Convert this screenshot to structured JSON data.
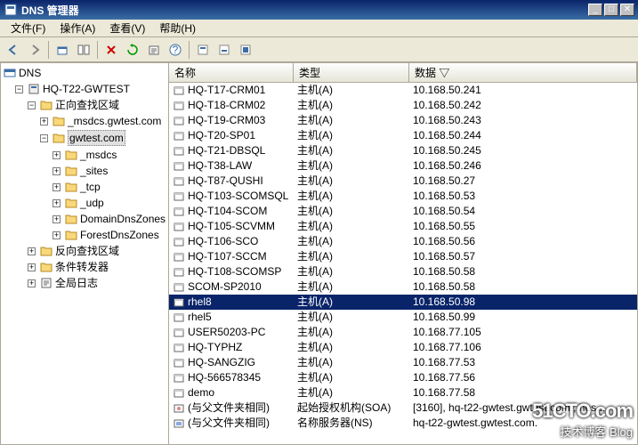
{
  "window": {
    "title": "DNS 管理器"
  },
  "menu": {
    "file": "文件(F)",
    "action": "操作(A)",
    "view": "查看(V)",
    "help": "帮助(H)"
  },
  "toolbar_icons": [
    "back",
    "forward",
    "up",
    "show-hide",
    "delete",
    "refresh",
    "export",
    "help",
    "filter-1",
    "filter-2",
    "filter-3"
  ],
  "columns": {
    "name": "名称",
    "type": "类型",
    "data": "数据  ▽"
  },
  "tree": {
    "root": "DNS",
    "server": "HQ-T22-GWTEST",
    "fwd_zone": "正向查找区域",
    "msdcs": "_msdcs.gwtest.com",
    "zone": "gwtest.com",
    "sub_msdcs": "_msdcs",
    "sub_sites": "_sites",
    "sub_tcp": "_tcp",
    "sub_udp": "_udp",
    "sub_ddz": "DomainDnsZones",
    "sub_fdz": "ForestDnsZones",
    "rev_zone": "反向查找区域",
    "cond_fwd": "条件转发器",
    "global_log": "全局日志"
  },
  "record_type_a": "主机(A)",
  "record_type_soa": "起始授权机构(SOA)",
  "record_type_ns": "名称服务器(NS)",
  "records": [
    {
      "name": "HQ-T17-CRM01",
      "type": "主机(A)",
      "data": "10.168.50.241",
      "sel": false,
      "icon": "host"
    },
    {
      "name": "HQ-T18-CRM02",
      "type": "主机(A)",
      "data": "10.168.50.242",
      "sel": false,
      "icon": "host"
    },
    {
      "name": "HQ-T19-CRM03",
      "type": "主机(A)",
      "data": "10.168.50.243",
      "sel": false,
      "icon": "host"
    },
    {
      "name": "HQ-T20-SP01",
      "type": "主机(A)",
      "data": "10.168.50.244",
      "sel": false,
      "icon": "host"
    },
    {
      "name": "HQ-T21-DBSQL",
      "type": "主机(A)",
      "data": "10.168.50.245",
      "sel": false,
      "icon": "host"
    },
    {
      "name": "HQ-T38-LAW",
      "type": "主机(A)",
      "data": "10.168.50.246",
      "sel": false,
      "icon": "host"
    },
    {
      "name": "HQ-T87-QUSHI",
      "type": "主机(A)",
      "data": "10.168.50.27",
      "sel": false,
      "icon": "host"
    },
    {
      "name": "HQ-T103-SCOMSQL",
      "type": "主机(A)",
      "data": "10.168.50.53",
      "sel": false,
      "icon": "host"
    },
    {
      "name": "HQ-T104-SCOM",
      "type": "主机(A)",
      "data": "10.168.50.54",
      "sel": false,
      "icon": "host"
    },
    {
      "name": "HQ-T105-SCVMM",
      "type": "主机(A)",
      "data": "10.168.50.55",
      "sel": false,
      "icon": "host"
    },
    {
      "name": "HQ-T106-SCO",
      "type": "主机(A)",
      "data": "10.168.50.56",
      "sel": false,
      "icon": "host"
    },
    {
      "name": "HQ-T107-SCCM",
      "type": "主机(A)",
      "data": "10.168.50.57",
      "sel": false,
      "icon": "host"
    },
    {
      "name": "HQ-T108-SCOMSP",
      "type": "主机(A)",
      "data": "10.168.50.58",
      "sel": false,
      "icon": "host"
    },
    {
      "name": "SCOM-SP2010",
      "type": "主机(A)",
      "data": "10.168.50.58",
      "sel": false,
      "icon": "host"
    },
    {
      "name": "rhel8",
      "type": "主机(A)",
      "data": "10.168.50.98",
      "sel": true,
      "icon": "host"
    },
    {
      "name": "rhel5",
      "type": "主机(A)",
      "data": "10.168.50.99",
      "sel": false,
      "icon": "host"
    },
    {
      "name": "USER50203-PC",
      "type": "主机(A)",
      "data": "10.168.77.105",
      "sel": false,
      "icon": "host"
    },
    {
      "name": "HQ-TYPHZ",
      "type": "主机(A)",
      "data": "10.168.77.106",
      "sel": false,
      "icon": "host"
    },
    {
      "name": "HQ-SANGZIG",
      "type": "主机(A)",
      "data": "10.168.77.53",
      "sel": false,
      "icon": "host"
    },
    {
      "name": "HQ-566578345",
      "type": "主机(A)",
      "data": "10.168.77.56",
      "sel": false,
      "icon": "host"
    },
    {
      "name": "demo",
      "type": "主机(A)",
      "data": "10.168.77.58",
      "sel": false,
      "icon": "host"
    },
    {
      "name": "(与父文件夹相同)",
      "type": "起始授权机构(SOA)",
      "data": "[3160], hq-t22-gwtest.gwtest.com., hos...",
      "sel": false,
      "icon": "soa"
    },
    {
      "name": "(与父文件夹相同)",
      "type": "名称服务器(NS)",
      "data": "hq-t22-gwtest.gwtest.com.",
      "sel": false,
      "icon": "ns"
    }
  ],
  "watermark": {
    "big": "51CTO.com",
    "sub": "技术博客        Blog"
  }
}
